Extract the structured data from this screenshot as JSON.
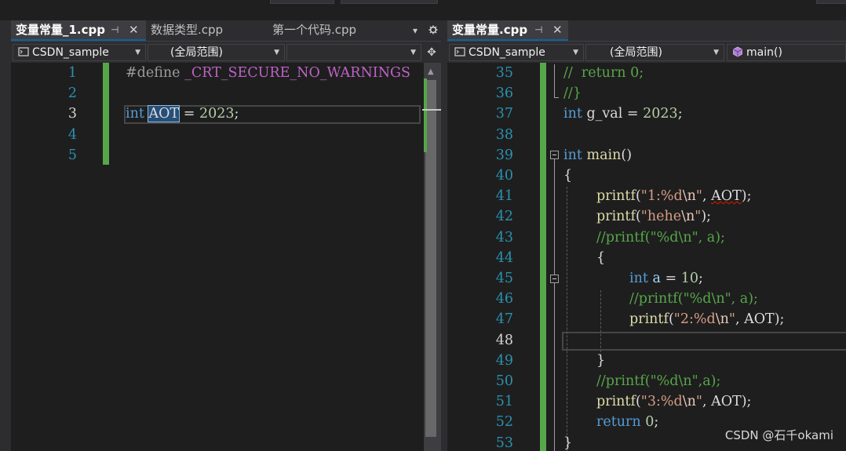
{
  "left_pane": {
    "tabs": [
      {
        "label": "变量常量_1.cpp",
        "active": true,
        "pin": "⊣",
        "close": "✕"
      },
      {
        "label": "数据类型.cpp",
        "active": false
      },
      {
        "label": "第一个代码.cpp",
        "active": false
      }
    ],
    "tab_dropdown_icon": "chevron-down-icon",
    "tab_settings_icon": "gear-icon",
    "nav": {
      "project": "CSDN_sample",
      "scope": "(全局范围)",
      "member": ""
    },
    "lines": [
      {
        "n": "1",
        "tokens": [
          {
            "t": "#define ",
            "c": "pp"
          },
          {
            "t": "_CRT_SECURE_NO_WARNINGS",
            "c": "mac"
          }
        ]
      },
      {
        "n": "2",
        "tokens": []
      },
      {
        "n": "3",
        "tokens": [
          {
            "t": "int",
            "c": "kw"
          },
          {
            "t": " ",
            "c": "plain"
          },
          {
            "t": "AOT",
            "c": "sel"
          },
          {
            "t": " = ",
            "c": "plain"
          },
          {
            "t": "2023",
            "c": "num"
          },
          {
            "t": ";",
            "c": "plain"
          }
        ]
      },
      {
        "n": "4",
        "tokens": []
      },
      {
        "n": "5",
        "tokens": []
      }
    ],
    "current_line": "3"
  },
  "right_pane": {
    "tabs": [
      {
        "label": "变量常量.cpp",
        "active": true,
        "pin": "⊣",
        "close": "✕"
      }
    ],
    "nav": {
      "project": "CSDN_sample",
      "scope": "(全局范围)",
      "member": "main()"
    },
    "lines": [
      {
        "n": "35",
        "indent": 0,
        "tokens": [
          {
            "t": "//  return 0;",
            "c": "cm"
          }
        ]
      },
      {
        "n": "36",
        "indent": 0,
        "tokens": [
          {
            "t": "//}",
            "c": "cm"
          }
        ]
      },
      {
        "n": "37",
        "indent": 0,
        "tokens": [
          {
            "t": "int",
            "c": "kw"
          },
          {
            "t": " g_val = ",
            "c": "plain"
          },
          {
            "t": "2023",
            "c": "num"
          },
          {
            "t": ";",
            "c": "plain"
          }
        ]
      },
      {
        "n": "38",
        "indent": 0,
        "tokens": []
      },
      {
        "n": "39",
        "indent": 0,
        "tokens": [
          {
            "t": "int",
            "c": "kw"
          },
          {
            "t": " ",
            "c": "plain"
          },
          {
            "t": "main",
            "c": "fn"
          },
          {
            "t": "()",
            "c": "plain"
          }
        ]
      },
      {
        "n": "40",
        "indent": 0,
        "tokens": [
          {
            "t": "{",
            "c": "plain"
          }
        ]
      },
      {
        "n": "41",
        "indent": 1,
        "tokens": [
          {
            "t": "printf",
            "c": "fn"
          },
          {
            "t": "(",
            "c": "plain"
          },
          {
            "t": "\"1:%d",
            "c": "st"
          },
          {
            "t": "\\n",
            "c": "esc"
          },
          {
            "t": "\"",
            "c": "st"
          },
          {
            "t": ", ",
            "c": "plain"
          },
          {
            "t": "AOT",
            "c": "squig"
          },
          {
            "t": ");",
            "c": "plain"
          }
        ]
      },
      {
        "n": "42",
        "indent": 1,
        "tokens": [
          {
            "t": "printf",
            "c": "fn"
          },
          {
            "t": "(",
            "c": "plain"
          },
          {
            "t": "\"hehe",
            "c": "st"
          },
          {
            "t": "\\n",
            "c": "esc"
          },
          {
            "t": "\"",
            "c": "st"
          },
          {
            "t": ");",
            "c": "plain"
          }
        ]
      },
      {
        "n": "43",
        "indent": 1,
        "tokens": [
          {
            "t": "//printf(\"%d\\n\", a);",
            "c": "cm"
          }
        ]
      },
      {
        "n": "44",
        "indent": 1,
        "tokens": [
          {
            "t": "{",
            "c": "plain"
          }
        ]
      },
      {
        "n": "45",
        "indent": 2,
        "tokens": [
          {
            "t": "int",
            "c": "kw"
          },
          {
            "t": " ",
            "c": "plain"
          },
          {
            "t": "a",
            "c": "var"
          },
          {
            "t": " = ",
            "c": "plain"
          },
          {
            "t": "10",
            "c": "num"
          },
          {
            "t": ";",
            "c": "plain"
          }
        ]
      },
      {
        "n": "46",
        "indent": 2,
        "tokens": [
          {
            "t": "//printf(\"%d\\n\", a);",
            "c": "cm"
          }
        ]
      },
      {
        "n": "47",
        "indent": 2,
        "tokens": [
          {
            "t": "printf",
            "c": "fn"
          },
          {
            "t": "(",
            "c": "plain"
          },
          {
            "t": "\"2:%d",
            "c": "st"
          },
          {
            "t": "\\n",
            "c": "esc"
          },
          {
            "t": "\"",
            "c": "st"
          },
          {
            "t": ", AOT);",
            "c": "plain"
          }
        ]
      },
      {
        "n": "48",
        "indent": 2,
        "tokens": []
      },
      {
        "n": "49",
        "indent": 1,
        "tokens": [
          {
            "t": "}",
            "c": "plain"
          }
        ]
      },
      {
        "n": "50",
        "indent": 1,
        "tokens": [
          {
            "t": "//printf(\"%d\\n\",a);",
            "c": "cm"
          }
        ]
      },
      {
        "n": "51",
        "indent": 1,
        "tokens": [
          {
            "t": "printf",
            "c": "fn"
          },
          {
            "t": "(",
            "c": "plain"
          },
          {
            "t": "\"3:%d",
            "c": "st"
          },
          {
            "t": "\\n",
            "c": "esc"
          },
          {
            "t": "\"",
            "c": "st"
          },
          {
            "t": ", AOT);",
            "c": "plain"
          }
        ]
      },
      {
        "n": "52",
        "indent": 1,
        "tokens": [
          {
            "t": "return",
            "c": "kw"
          },
          {
            "t": " ",
            "c": "plain"
          },
          {
            "t": "0",
            "c": "num"
          },
          {
            "t": ";",
            "c": "plain"
          }
        ]
      },
      {
        "n": "53",
        "indent": 0,
        "tokens": [
          {
            "t": "}",
            "c": "plain"
          }
        ]
      }
    ],
    "current_line": "48"
  },
  "watermark": "CSDN @石千okami",
  "colors": {
    "keyword": "#569cd6",
    "comment": "#57a64a",
    "string": "#d69d85",
    "function": "#dcdcaa",
    "number": "#b5cea8",
    "macro": "#bd63c5",
    "change_bar": "#57a64a"
  }
}
